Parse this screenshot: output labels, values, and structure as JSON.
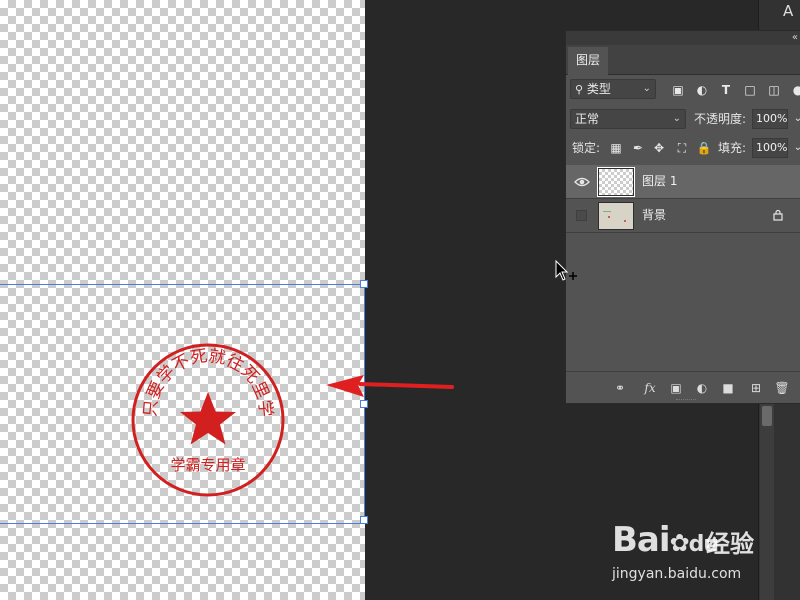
{
  "layers_panel": {
    "tab_label": "图层",
    "filter_kind": "类型",
    "blend_mode": "正常",
    "opacity_label": "不透明度:",
    "opacity_value": "100%",
    "lock_label": "锁定:",
    "fill_label": "填充:",
    "fill_value": "100%",
    "layers": [
      {
        "name": "图层 1",
        "visible": true,
        "selected": true,
        "thumbnail": "transparent"
      },
      {
        "name": "背景",
        "visible": false,
        "selected": false,
        "thumbnail": "background",
        "locked": true
      }
    ],
    "bottom_icons": [
      "link-icon",
      "fx-icon",
      "mask-icon",
      "adjustment-icon",
      "folder-icon",
      "new-layer-icon",
      "trash-icon"
    ]
  },
  "right_toolbar": {
    "top_button_label": "A"
  },
  "canvas": {
    "seal": {
      "top_text": "只要学不死就往死里学",
      "bottom_text": "学霸专用章",
      "color": "#d21f1f"
    },
    "arrow_color": "#e02020",
    "selection_color": "#4c7fd9"
  },
  "watermark": {
    "logo_text": "Bai",
    "logo_suffix": "du",
    "brand_text": "经验",
    "url": "jingyan.baidu.com"
  },
  "colors": {
    "panel_bg": "#535353",
    "workspace_bg": "#282828",
    "selected_layer_bg": "#666666"
  }
}
